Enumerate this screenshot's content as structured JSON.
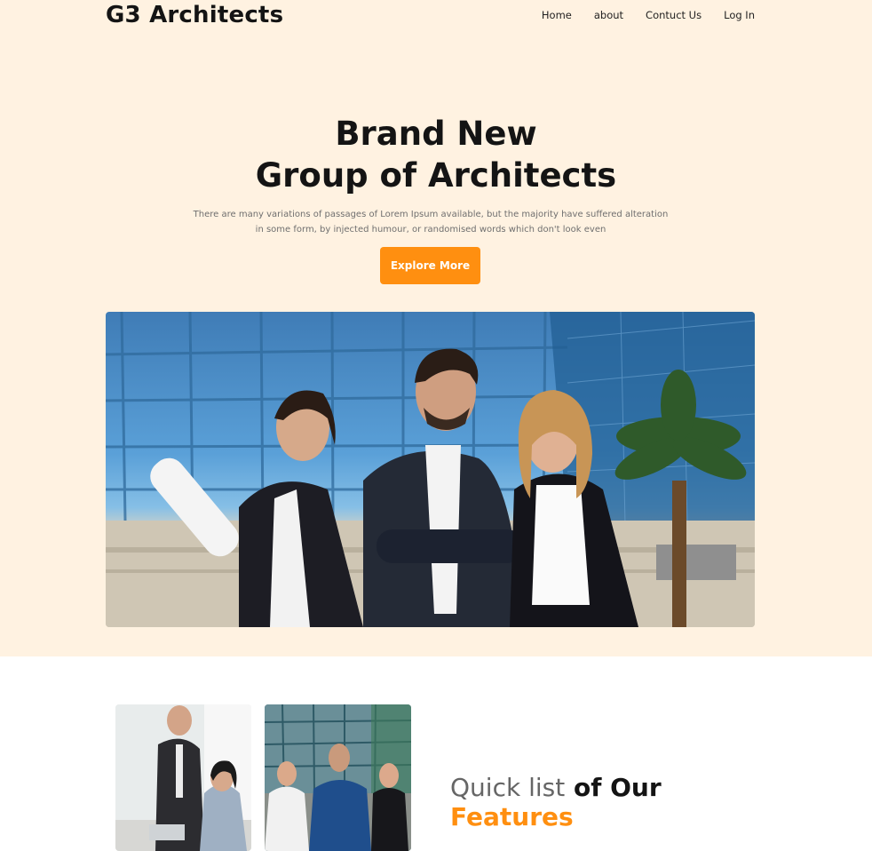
{
  "brand": "G3 Architects",
  "nav": {
    "items": [
      "Home",
      "about",
      "Contuct Us",
      "Log In"
    ]
  },
  "hero": {
    "title_line1": "Brand New",
    "title_line2": "Group of Architects",
    "subtitle": "There are many variations of passages of Lorem Ipsum available, but the majority have suffered alteration in some form, by injected humour, or randomised words which don't look even",
    "cta_label": "Explore More",
    "accent_color": "#ff8f10",
    "background_color": "#fff2e1"
  },
  "features": {
    "title_light": "Quick list",
    "title_dark": "of Our",
    "title_accent": "Features"
  }
}
